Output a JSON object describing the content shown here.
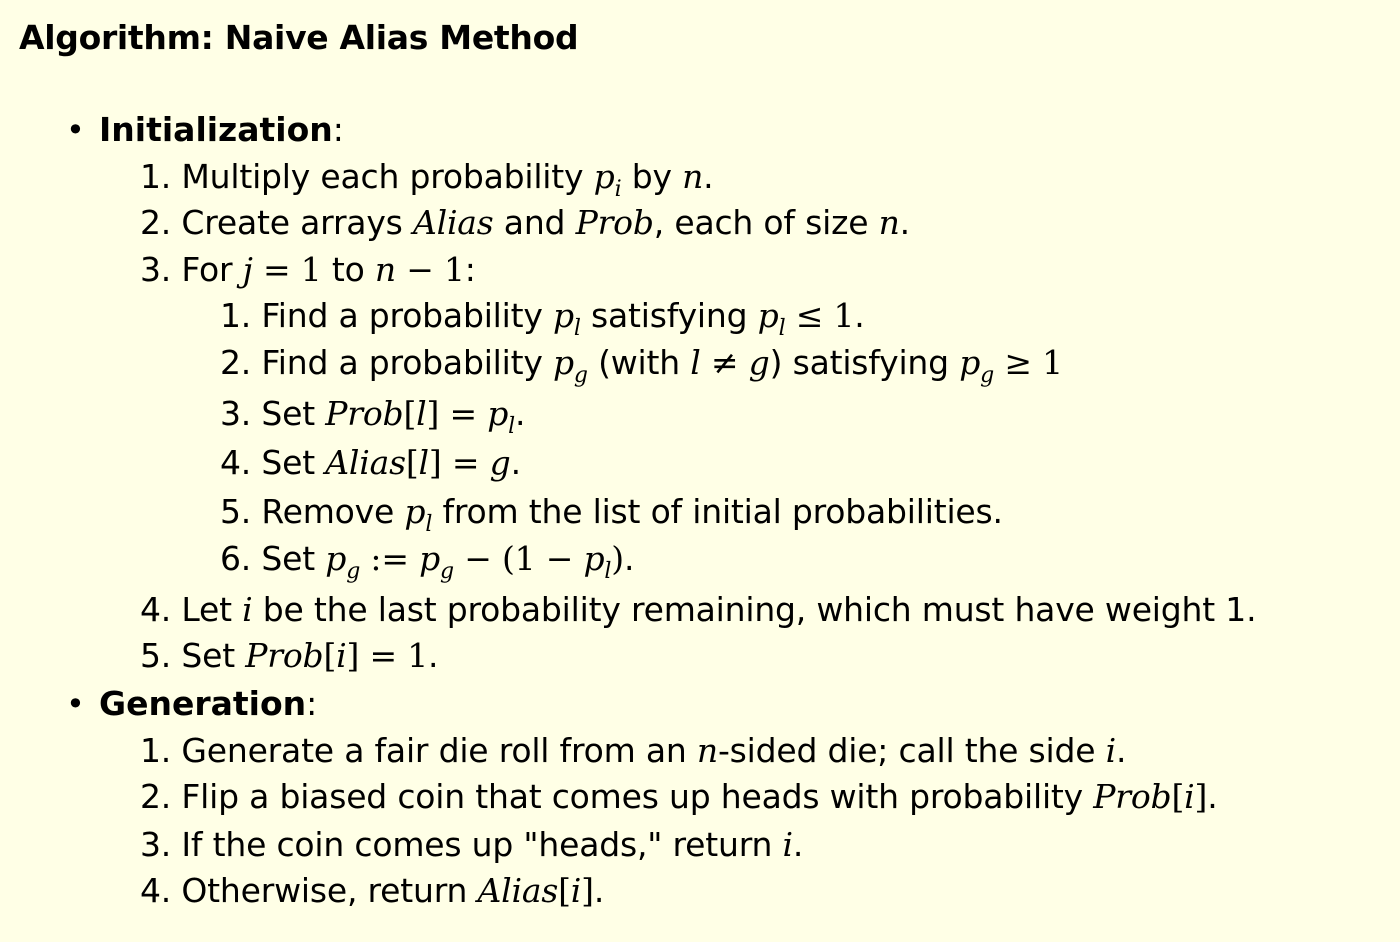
{
  "title": "Algorithm: Naive Alias Method",
  "sections": [
    {
      "heading": "Initialization",
      "heading_suffix": ":",
      "steps": [
        {
          "number": "1.",
          "text": "Multiply each probability p_i by n."
        },
        {
          "number": "2.",
          "text": "Create arrays Alias and Prob, each of size n."
        },
        {
          "number": "3.",
          "text": "For j = 1 to n − 1:"
        },
        {
          "number": "4.",
          "text": "Let i be the last probability remaining, which must have weight 1."
        },
        {
          "number": "5.",
          "text": "Set Prob[i] = 1."
        }
      ],
      "substeps": [
        {
          "number": "1.",
          "text": "Find a probability p_l satisfying p_l ≤ 1."
        },
        {
          "number": "2.",
          "text": "Find a probability p_g (with l ≠ g) satisfying p_g ≥ 1"
        },
        {
          "number": "3.",
          "text": "Set Prob[l] = p_l."
        },
        {
          "number": "4.",
          "text": "Set Alias[l] = g."
        },
        {
          "number": "5.",
          "text": "Remove p_l from the list of initial probabilities."
        },
        {
          "number": "6.",
          "text": "Set p_g := p_g − (1 − p_l)."
        }
      ]
    },
    {
      "heading": "Generation",
      "heading_suffix": ":",
      "steps": [
        {
          "number": "1.",
          "text": "Generate a fair die roll from an n-sided die; call the side i."
        },
        {
          "number": "2.",
          "text": "Flip a biased coin that comes up heads with probability Prob[i]."
        },
        {
          "number": "3.",
          "text": "If the coin comes up \"heads,\" return i."
        },
        {
          "number": "4.",
          "text": "Otherwise, return Alias[i]."
        }
      ]
    }
  ],
  "math": {
    "p": "p",
    "n": "n",
    "i": "i",
    "j": "j",
    "l": "l",
    "g": "g",
    "one": "1",
    "alias": "Alias",
    "prob": "Prob",
    "eq": "=",
    "leq": "≤",
    "geq": "≥",
    "neq": "≠",
    "minus": "−",
    "assign": ":=",
    "lbr": "[",
    "rbr": "]",
    "lpar": "(",
    "rpar": ")"
  },
  "words": {
    "bullet": "•",
    "w_multiply": "Multiply each probability ",
    "w_by": " by ",
    "w_period": ".",
    "w_create": "Create arrays ",
    "w_and": " and ",
    "w_each_size": ", each of size ",
    "w_for": "For ",
    "w_to": " to ",
    "w_colon": ":",
    "w_find_a": "Find a probability ",
    "w_satisfying": " satisfying ",
    "w_with": " (with ",
    "w_close_paren": ")",
    "w_set": "Set ",
    "w_remove": "Remove ",
    "w_from_list": " from the list of initial probabilities.",
    "w_let": "Let ",
    "w_last_prob": " be the last probability remaining, which must have weight 1.",
    "w_generate": "Generate a fair die roll from an ",
    "w_sided": "-sided die; call the side ",
    "w_flip": "Flip a biased coin that comes up heads with probability ",
    "w_if_coin": "If the coin comes up \"heads,\" return ",
    "w_otherwise": "Otherwise, return "
  }
}
